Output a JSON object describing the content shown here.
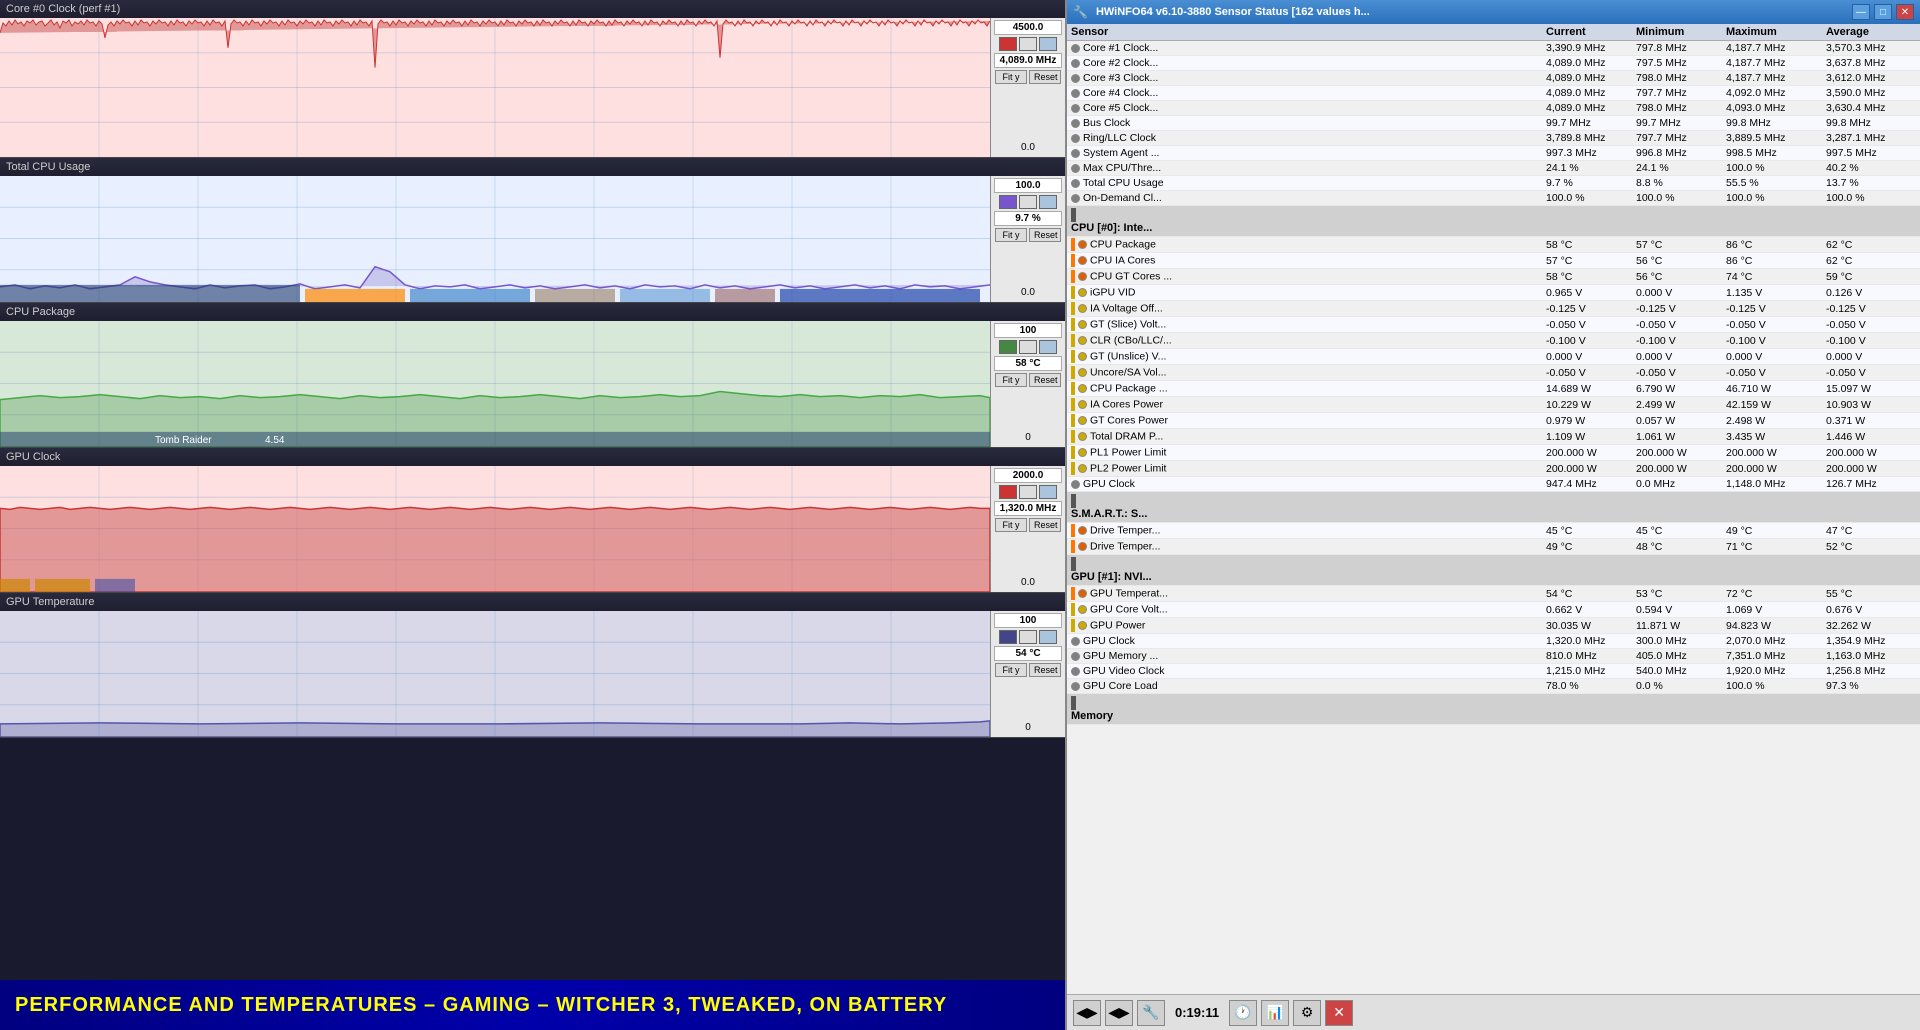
{
  "left": {
    "title": "Core #0 Clock (perf #1)",
    "sections": [
      {
        "id": "core-clock",
        "label": "Core #0 Clock (perf #1)",
        "top_value": "4500.0",
        "current_value": "4,089.0 MHz",
        "bottom_value": "0.0",
        "bg_color": "#ffe8e8",
        "line_color": "#cc2222",
        "fill_color": "rgba(200,60,60,0.5)"
      },
      {
        "id": "total-cpu",
        "label": "Total CPU Usage",
        "top_value": "100.0",
        "current_value": "9.7 %",
        "bottom_value": "0.0",
        "bg_color": "#e8eeff",
        "line_color": "#6644aa",
        "fill_color": "rgba(100,80,180,0.3)"
      },
      {
        "id": "cpu-package",
        "label": "CPU Package",
        "top_value": "100",
        "current_value": "58 °C",
        "bottom_value": "0",
        "bg_color": "#d8e8d8",
        "line_color": "#448844",
        "fill_color": "rgba(80,160,80,0.3)"
      },
      {
        "id": "gpu-clock",
        "label": "GPU Clock",
        "top_value": "2000.0",
        "current_value": "1,320.0 MHz",
        "bottom_value": "0.0",
        "bg_color": "#ffe8e8",
        "line_color": "#cc2222",
        "fill_color": "rgba(200,60,60,0.5)"
      },
      {
        "id": "gpu-temp",
        "label": "GPU Temperature",
        "top_value": "100",
        "current_value": "54 °C",
        "bottom_value": "0",
        "bg_color": "#d8d8e8",
        "line_color": "#444488",
        "fill_color": "rgba(80,80,160,0.3)"
      }
    ],
    "bottom_text": "PERFORMANCE AND TEMPERATURES – GAMING – WITCHER 3, TWEAKED, ON BATTERY",
    "taskbar_items": [
      "Tomb Raider",
      "4.54"
    ]
  },
  "hwinfo": {
    "title": "HWiNFO64 v6.10-3880 Sensor Status [162 values h...",
    "columns": [
      "Sensor",
      "Current",
      "Minimum",
      "Maximum",
      "Average"
    ],
    "rows": [
      {
        "type": "data",
        "icon": "gray",
        "bar": "none",
        "name": "Core #1 Clock...",
        "current": "3,390.9 MHz",
        "minimum": "797.8 MHz",
        "maximum": "4,187.7 MHz",
        "average": "3,570.3 MHz"
      },
      {
        "type": "data",
        "icon": "gray",
        "bar": "none",
        "name": "Core #2 Clock...",
        "current": "4,089.0 MHz",
        "minimum": "797.5 MHz",
        "maximum": "4,187.7 MHz",
        "average": "3,637.8 MHz"
      },
      {
        "type": "data",
        "icon": "gray",
        "bar": "none",
        "name": "Core #3 Clock...",
        "current": "4,089.0 MHz",
        "minimum": "798.0 MHz",
        "maximum": "4,187.7 MHz",
        "average": "3,612.0 MHz"
      },
      {
        "type": "data",
        "icon": "gray",
        "bar": "none",
        "name": "Core #4 Clock...",
        "current": "4,089.0 MHz",
        "minimum": "797.7 MHz",
        "maximum": "4,092.0 MHz",
        "average": "3,590.0 MHz"
      },
      {
        "type": "data",
        "icon": "gray",
        "bar": "none",
        "name": "Core #5 Clock...",
        "current": "4,089.0 MHz",
        "minimum": "798.0 MHz",
        "maximum": "4,093.0 MHz",
        "average": "3,630.4 MHz"
      },
      {
        "type": "data",
        "icon": "gray",
        "bar": "none",
        "name": "Bus Clock",
        "current": "99.7 MHz",
        "minimum": "99.7 MHz",
        "maximum": "99.8 MHz",
        "average": "99.8 MHz"
      },
      {
        "type": "data",
        "icon": "gray",
        "bar": "none",
        "name": "Ring/LLC Clock",
        "current": "3,789.8 MHz",
        "minimum": "797.7 MHz",
        "maximum": "3,889.5 MHz",
        "average": "3,287.1 MHz"
      },
      {
        "type": "data",
        "icon": "gray",
        "bar": "none",
        "name": "System Agent ...",
        "current": "997.3 MHz",
        "minimum": "996.8 MHz",
        "maximum": "998.5 MHz",
        "average": "997.5 MHz"
      },
      {
        "type": "data",
        "icon": "gray",
        "bar": "none",
        "name": "Max CPU/Thre...",
        "current": "24.1 %",
        "minimum": "24.1 %",
        "maximum": "100.0 %",
        "average": "40.2 %"
      },
      {
        "type": "data",
        "icon": "gray",
        "bar": "none",
        "name": "Total CPU Usage",
        "current": "9.7 %",
        "minimum": "8.8 %",
        "maximum": "55.5 %",
        "average": "13.7 %"
      },
      {
        "type": "data",
        "icon": "gray",
        "bar": "none",
        "name": "On-Demand Cl...",
        "current": "100.0 %",
        "minimum": "100.0 %",
        "maximum": "100.0 %",
        "average": "100.0 %"
      },
      {
        "type": "section",
        "name": "CPU [#0]: Inte..."
      },
      {
        "type": "data",
        "icon": "orange",
        "bar": "orange",
        "name": "CPU Package",
        "current": "58 °C",
        "minimum": "57 °C",
        "maximum": "86 °C",
        "average": "62 °C"
      },
      {
        "type": "data",
        "icon": "orange",
        "bar": "orange",
        "name": "CPU IA Cores",
        "current": "57 °C",
        "minimum": "56 °C",
        "maximum": "86 °C",
        "average": "62 °C"
      },
      {
        "type": "data",
        "icon": "orange",
        "bar": "orange",
        "name": "CPU GT Cores ...",
        "current": "58 °C",
        "minimum": "56 °C",
        "maximum": "74 °C",
        "average": "59 °C"
      },
      {
        "type": "data",
        "icon": "yellow",
        "bar": "yellow",
        "name": "iGPU VID",
        "current": "0.965 V",
        "minimum": "0.000 V",
        "maximum": "1.135 V",
        "average": "0.126 V"
      },
      {
        "type": "data",
        "icon": "yellow",
        "bar": "yellow",
        "name": "IA Voltage Off...",
        "current": "-0.125 V",
        "minimum": "-0.125 V",
        "maximum": "-0.125 V",
        "average": "-0.125 V"
      },
      {
        "type": "data",
        "icon": "yellow",
        "bar": "yellow",
        "name": "GT (Slice) Volt...",
        "current": "-0.050 V",
        "minimum": "-0.050 V",
        "maximum": "-0.050 V",
        "average": "-0.050 V"
      },
      {
        "type": "data",
        "icon": "yellow",
        "bar": "yellow",
        "name": "CLR (CBo/LLC/...",
        "current": "-0.100 V",
        "minimum": "-0.100 V",
        "maximum": "-0.100 V",
        "average": "-0.100 V"
      },
      {
        "type": "data",
        "icon": "yellow",
        "bar": "yellow",
        "name": "GT (Unslice) V...",
        "current": "0.000 V",
        "minimum": "0.000 V",
        "maximum": "0.000 V",
        "average": "0.000 V"
      },
      {
        "type": "data",
        "icon": "yellow",
        "bar": "yellow",
        "name": "Uncore/SA Vol...",
        "current": "-0.050 V",
        "minimum": "-0.050 V",
        "maximum": "-0.050 V",
        "average": "-0.050 V"
      },
      {
        "type": "data",
        "icon": "yellow",
        "bar": "yellow",
        "name": "CPU Package ...",
        "current": "14.689 W",
        "minimum": "6.790 W",
        "maximum": "46.710 W",
        "average": "15.097 W"
      },
      {
        "type": "data",
        "icon": "yellow",
        "bar": "yellow",
        "name": "IA Cores Power",
        "current": "10.229 W",
        "minimum": "2.499 W",
        "maximum": "42.159 W",
        "average": "10.903 W"
      },
      {
        "type": "data",
        "icon": "yellow",
        "bar": "yellow",
        "name": "GT Cores Power",
        "current": "0.979 W",
        "minimum": "0.057 W",
        "maximum": "2.498 W",
        "average": "0.371 W"
      },
      {
        "type": "data",
        "icon": "yellow",
        "bar": "yellow",
        "name": "Total DRAM P...",
        "current": "1.109 W",
        "minimum": "1.061 W",
        "maximum": "3.435 W",
        "average": "1.446 W"
      },
      {
        "type": "data",
        "icon": "yellow",
        "bar": "yellow",
        "name": "PL1 Power Limit",
        "current": "200.000 W",
        "minimum": "200.000 W",
        "maximum": "200.000 W",
        "average": "200.000 W"
      },
      {
        "type": "data",
        "icon": "yellow",
        "bar": "yellow",
        "name": "PL2 Power Limit",
        "current": "200.000 W",
        "minimum": "200.000 W",
        "maximum": "200.000 W",
        "average": "200.000 W"
      },
      {
        "type": "data",
        "icon": "gray",
        "bar": "none",
        "name": "GPU Clock",
        "current": "947.4 MHz",
        "minimum": "0.0 MHz",
        "maximum": "1,148.0 MHz",
        "average": "126.7 MHz"
      },
      {
        "type": "section",
        "name": "S.M.A.R.T.: S..."
      },
      {
        "type": "data",
        "icon": "orange",
        "bar": "orange",
        "name": "Drive Temper...",
        "current": "45 °C",
        "minimum": "45 °C",
        "maximum": "49 °C",
        "average": "47 °C"
      },
      {
        "type": "data",
        "icon": "orange",
        "bar": "orange",
        "name": "Drive Temper...",
        "current": "49 °C",
        "minimum": "48 °C",
        "maximum": "71 °C",
        "average": "52 °C"
      },
      {
        "type": "section",
        "name": "GPU [#1]: NVI..."
      },
      {
        "type": "data",
        "icon": "orange",
        "bar": "orange",
        "name": "GPU Temperat...",
        "current": "54 °C",
        "minimum": "53 °C",
        "maximum": "72 °C",
        "average": "55 °C"
      },
      {
        "type": "data",
        "icon": "yellow",
        "bar": "yellow",
        "name": "GPU Core Volt...",
        "current": "0.662 V",
        "minimum": "0.594 V",
        "maximum": "1.069 V",
        "average": "0.676 V"
      },
      {
        "type": "data",
        "icon": "yellow",
        "bar": "yellow",
        "name": "GPU Power",
        "current": "30.035 W",
        "minimum": "11.871 W",
        "maximum": "94.823 W",
        "average": "32.262 W"
      },
      {
        "type": "data",
        "icon": "gray",
        "bar": "none",
        "name": "GPU Clock",
        "current": "1,320.0 MHz",
        "minimum": "300.0 MHz",
        "maximum": "2,070.0 MHz",
        "average": "1,354.9 MHz"
      },
      {
        "type": "data",
        "icon": "gray",
        "bar": "none",
        "name": "GPU Memory ...",
        "current": "810.0 MHz",
        "minimum": "405.0 MHz",
        "maximum": "7,351.0 MHz",
        "average": "1,163.0 MHz"
      },
      {
        "type": "data",
        "icon": "gray",
        "bar": "none",
        "name": "GPU Video Clock",
        "current": "1,215.0 MHz",
        "minimum": "540.0 MHz",
        "maximum": "1,920.0 MHz",
        "average": "1,256.8 MHz"
      },
      {
        "type": "data",
        "icon": "gray",
        "bar": "none",
        "name": "GPU Core Load",
        "current": "78.0 %",
        "minimum": "0.0 %",
        "maximum": "100.0 %",
        "average": "97.3 %"
      },
      {
        "type": "section",
        "name": "Memory"
      }
    ],
    "bottom_buttons": [
      "◀▶",
      "◀▶",
      "🔧",
      "🕐",
      "📊",
      "⚙",
      "✕"
    ],
    "time": "0:19:11"
  }
}
